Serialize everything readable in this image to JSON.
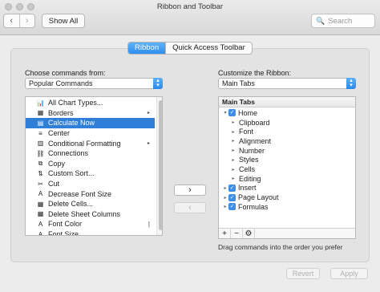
{
  "window": {
    "title": "Ribbon and Toolbar"
  },
  "toolbar": {
    "back": "‹",
    "forward": "›",
    "show_all": "Show All",
    "search_placeholder": "Search",
    "search_icon": "🔍"
  },
  "tabs": {
    "ribbon": "Ribbon",
    "quick_access": "Quick Access Toolbar"
  },
  "left": {
    "label": "Choose commands from:",
    "dropdown_value": "Popular Commands",
    "commands": [
      {
        "label": "All Chart Types...",
        "icon": "📊",
        "sub": "",
        "selected": false
      },
      {
        "label": "Borders",
        "icon": "▦",
        "sub": "▸",
        "selected": false
      },
      {
        "label": "Calculate Now",
        "icon": "▤",
        "sub": "",
        "selected": true
      },
      {
        "label": "Center",
        "icon": "≡",
        "sub": "",
        "selected": false
      },
      {
        "label": "Conditional Formatting",
        "icon": "▥",
        "sub": "▸",
        "selected": false
      },
      {
        "label": "Connections",
        "icon": "⛓",
        "sub": "",
        "selected": false
      },
      {
        "label": "Copy",
        "icon": "⧉",
        "sub": "",
        "selected": false
      },
      {
        "label": "Custom Sort...",
        "icon": "⇅",
        "sub": "",
        "selected": false
      },
      {
        "label": "Cut",
        "icon": "✂",
        "sub": "",
        "selected": false
      },
      {
        "label": "Decrease Font Size",
        "icon": "A",
        "sub": "",
        "selected": false
      },
      {
        "label": "Delete Cells...",
        "icon": "▦",
        "sub": "",
        "selected": false
      },
      {
        "label": "Delete Sheet Columns",
        "icon": "▦",
        "sub": "",
        "selected": false
      },
      {
        "label": "Font Color",
        "icon": "A",
        "sub": "|",
        "selected": false
      },
      {
        "label": "Font Size",
        "icon": "A",
        "sub": "",
        "selected": false
      }
    ]
  },
  "middle": {
    "add": "›",
    "remove": "‹"
  },
  "right": {
    "label": "Customize the Ribbon:",
    "dropdown_value": "Main Tabs",
    "tree_header": "Main Tabs",
    "tree": [
      {
        "label": "Home",
        "level": 0,
        "expanded": true,
        "checkbox": true,
        "check": "✓",
        "tri": "▾"
      },
      {
        "label": "Clipboard",
        "level": 1,
        "expanded": false,
        "checkbox": false,
        "check": "",
        "tri": "▸"
      },
      {
        "label": "Font",
        "level": 1,
        "expanded": false,
        "checkbox": false,
        "check": "",
        "tri": "▸"
      },
      {
        "label": "Alignment",
        "level": 1,
        "expanded": false,
        "checkbox": false,
        "check": "",
        "tri": "▸"
      },
      {
        "label": "Number",
        "level": 1,
        "expanded": false,
        "checkbox": false,
        "check": "",
        "tri": "▸"
      },
      {
        "label": "Styles",
        "level": 1,
        "expanded": false,
        "checkbox": false,
        "check": "",
        "tri": "▸"
      },
      {
        "label": "Cells",
        "level": 1,
        "expanded": false,
        "checkbox": false,
        "check": "",
        "tri": "▸"
      },
      {
        "label": "Editing",
        "level": 1,
        "expanded": false,
        "checkbox": false,
        "check": "",
        "tri": "▸"
      },
      {
        "label": "Insert",
        "level": 0,
        "expanded": false,
        "checkbox": true,
        "check": "✓",
        "tri": "▸"
      },
      {
        "label": "Page Layout",
        "level": 0,
        "expanded": false,
        "checkbox": true,
        "check": "✓",
        "tri": "▸"
      },
      {
        "label": "Formulas",
        "level": 0,
        "expanded": false,
        "checkbox": true,
        "check": "✓",
        "tri": "▸"
      }
    ],
    "tree_toolbar": {
      "add": "+",
      "remove": "−",
      "settings": "⚙"
    },
    "hint": "Drag commands into the order you prefer"
  },
  "footer": {
    "revert": "Revert",
    "apply": "Apply"
  },
  "colors": {
    "accent": "#2f7ed8",
    "selection": "#2f7ed8"
  }
}
